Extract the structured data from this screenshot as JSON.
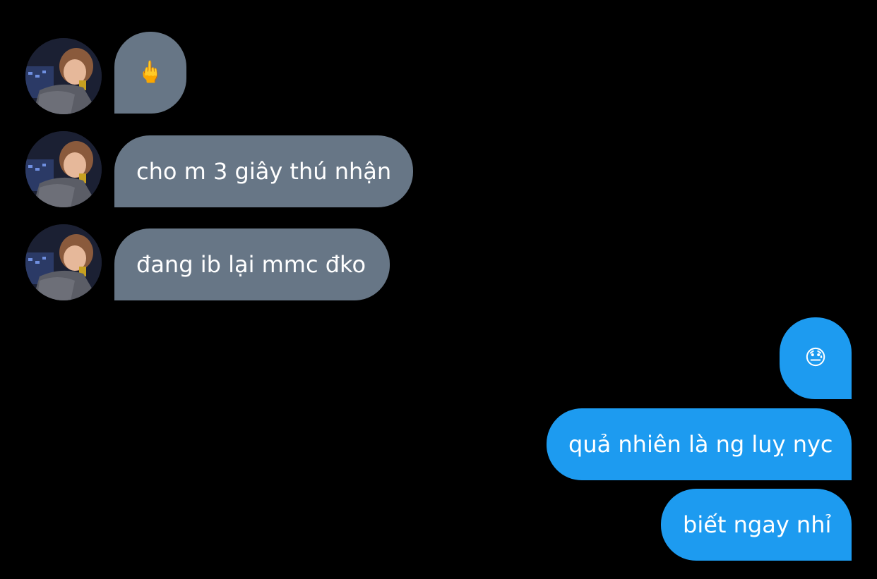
{
  "conversation": {
    "incoming": [
      {
        "text": "🖕",
        "is_emoji": true
      },
      {
        "text": "cho m 3 giây thú nhận",
        "is_emoji": false
      },
      {
        "text": "đang ib lại mmc đko",
        "is_emoji": false
      }
    ],
    "outgoing": [
      {
        "text": "😓",
        "is_emoji": true
      },
      {
        "text": "quả nhiên là ng luỵ nyc",
        "is_emoji": false
      },
      {
        "text": "biết ngay nhỉ",
        "is_emoji": false
      }
    ]
  },
  "colors": {
    "background": "#000000",
    "incoming_bubble": "#677686",
    "outgoing_bubble": "#1d9bf0",
    "text": "#ffffff"
  }
}
